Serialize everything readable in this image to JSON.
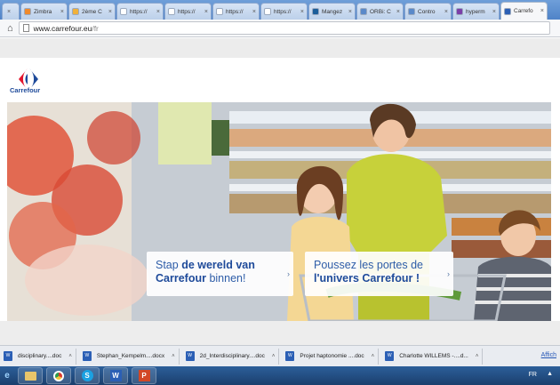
{
  "browser": {
    "tabs": [
      {
        "label": "",
        "color": "#dfe6ef",
        "active": false
      },
      {
        "label": "Zimbra",
        "color": "#f08a2c",
        "active": false
      },
      {
        "label": "2ème C",
        "color": "#f0b13a",
        "active": false
      },
      {
        "label": "https://",
        "color": "#ffffff",
        "active": false
      },
      {
        "label": "https://",
        "color": "#ffffff",
        "active": false
      },
      {
        "label": "https://",
        "color": "#ffffff",
        "active": false
      },
      {
        "label": "https://",
        "color": "#ffffff",
        "active": false
      },
      {
        "label": "Mangez",
        "color": "#1b5e9a",
        "active": false
      },
      {
        "label": "ORBi: C",
        "color": "#5a89c9",
        "active": false
      },
      {
        "label": "Contro",
        "color": "#5a89c9",
        "active": false
      },
      {
        "label": "hyperm",
        "color": "#7b3fa8",
        "active": false
      },
      {
        "label": "Carrefo",
        "color": "#2b5fb5",
        "active": true
      }
    ],
    "close_glyph": "×",
    "home_glyph": "⌂",
    "url_host": "www.carrefour.eu",
    "url_path": "/fr"
  },
  "page": {
    "logo_text": "Carrefour",
    "cta_left": {
      "line1": "Stap ",
      "bold1": "de wereld van",
      "bold2": "Carrefour",
      "line2": " binnen!",
      "arrow": "›"
    },
    "cta_right": {
      "line1": "Poussez les portes de",
      "bold2": "l'univers Carrefour !",
      "arrow": "›"
    }
  },
  "downloads": {
    "items": [
      {
        "label": "disciplinary....doc",
        "icon": "W"
      },
      {
        "label": "Stephan_Kempelm....docx",
        "icon": "W"
      },
      {
        "label": "2d_Interdisciplinary....doc",
        "icon": "W"
      },
      {
        "label": "Projet haptonomie ....doc",
        "icon": "W"
      },
      {
        "label": "Charlotte WILLEMS -....d...",
        "icon": "W"
      }
    ],
    "show_all": "Affich"
  },
  "taskbar": {
    "lang": "FR",
    "tray": "▲"
  }
}
